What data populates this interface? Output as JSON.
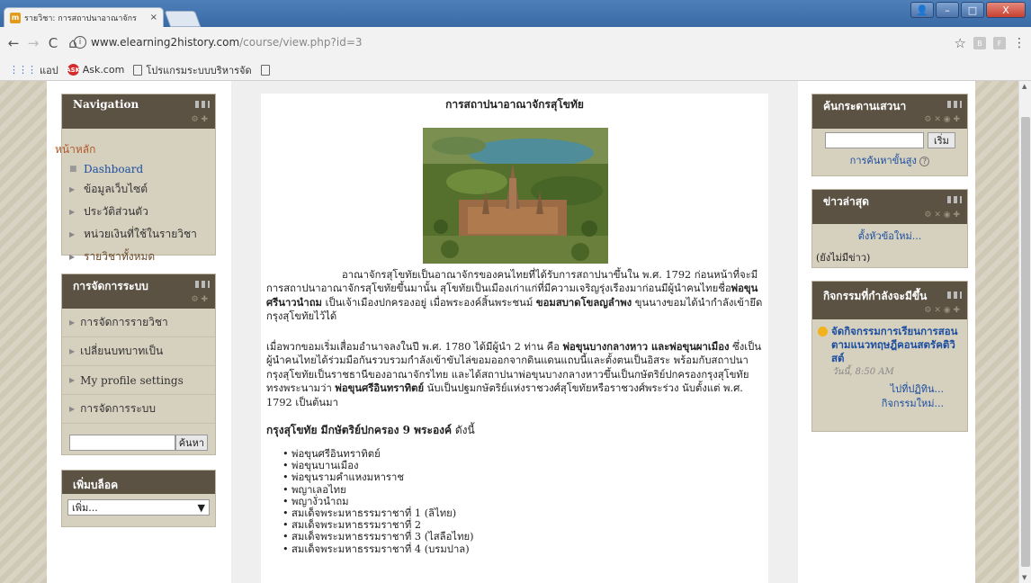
{
  "browser": {
    "tab_title": "รายวิชา: การสถาปนาอาณาจักร",
    "tab_close": "×",
    "url_host": "www.elearning2history.com",
    "url_path": "/course/view.php?id=3",
    "nav_back": "←",
    "nav_forward": "→",
    "nav_reload": "C",
    "nav_home": "⌂",
    "info_icon": "i",
    "star": "☆",
    "ext1": "B",
    "ext2": "F",
    "menu": "⋮",
    "win_min": "–",
    "win_max": "□",
    "win_close": "X"
  },
  "bookmarks": {
    "apps": "แอป",
    "ask": "Ask.com",
    "item1": "โปรแกรมระบบบริหารจัด"
  },
  "navigation": {
    "title": "Navigation",
    "home": "หน้าหลัก",
    "items": [
      "Dashboard",
      "ข้อมูลเว็บไซต์",
      "ประวัติส่วนตัว",
      "หน่วยเงินที่ใช้ในรายวิชา",
      "รายวิชาทั้งหมด"
    ]
  },
  "admin": {
    "title": "การจัดการระบบ",
    "items": [
      "การจัดการรายวิชา",
      "เปลี่ยนบทบาทเป็น",
      "My profile settings",
      "การจัดการระบบ"
    ],
    "search_button": "ค้นหา"
  },
  "addblock": {
    "title": "เพิ่มบล็อค",
    "select_value": "เพิ่ม..."
  },
  "forum_search": {
    "title": "ค้นกระดานเสวนา",
    "button": "เริ่ม",
    "advanced": "การค้นหาขั้นสูง"
  },
  "news": {
    "title": "ข่าวล่าสุด",
    "add": "ตั้งหัวข้อใหม่...",
    "none": "(ยังไม่มีข่าว)"
  },
  "events": {
    "title": "กิจกรรมที่กำลังจะมีขึ้น",
    "event_title": "จัดกิจกรรมการเรียนการสอนตามแนวทฤษฎีคอนสตรัคติวิสต์",
    "event_time": "วันนี้, 8:50 AM",
    "link_goto": "ไปที่ปฏิทิน...",
    "link_new": "กิจกรรมใหม่..."
  },
  "content": {
    "heading": "การสถาปนาอาณาจักรสุโขทัย",
    "para1_a": "อาณาจักรสุโขทัยเป็นอาณาจักรของคนไทยที่ได้รับการสถาปนาขึ้นใน พ.ศ. 1792 ก่อนหน้าที่จะมีการสถาปนาอาณาจักรสุโขทัยขึ้นมานั้น สุโขทัยเป็นเมืองเก่าแก่ที่มีความเจริญรุ่งเรืองมาก่อนมีผู้นำคนไทยชื่อ",
    "para1_b1": "พ่อขุนศรีนาวนำถม",
    "para1_c": " เป็นเจ้าเมืองปกครองอยู่ เมื่อพระองค์สิ้นพระชนม์ ",
    "para1_b2": "ขอมสบาดโขลญลำพง",
    "para1_d": " ขุนนางขอมได้นำกำลังเข้ายึดกรุงสุโขทัยไว้ได้",
    "para2_a": "เมื่อพวกขอมเริ่มเสื่อมอำนาจลงในปี พ.ศ. 1780 ได้มีผู้นำ 2 ท่าน คือ ",
    "para2_b1": "พ่อขุนบางกลางหาว และพ่อขุนผาเมือง",
    "para2_c": " ซึ่งเป็นผู้นำคนไทยได้ร่วมมือกันรวบรวมกำลังเข้าขับไล่ขอมออกจากดินแดนแถบนี้และตั้งตนเป็นอิสระ พร้อมกับสถาปนากรุงสุโขทัยเป็นราชธานีของอาณาจักรไทย และได้สถาปนาพ่อขุนบางกลางหาวขึ้นเป็นกษัตริย์ปกครองกรุงสุโขทัยทรงพระนามว่า ",
    "para2_b2": "พ่อขุนศรีอินทราทิตย์",
    "para2_d": " นับเป็นปฐมกษัตริย์แห่งราชวงศ์สุโขทัยหรือราชวงศ์พระร่วง นับตั้งแต่ พ.ศ. 1792 เป็นต้นมา",
    "kings_heading": "กรุงสุโขทัย มีกษัตริย์ปกครอง 9 พระองค์",
    "kings_heading_suffix": " ดังนี้",
    "kings": [
      "พ่อขุนศรีอินทราทิตย์",
      "พ่อขุนบานเมือง",
      "พ่อขุนรามคำแหงมหาราช",
      "พญาเลอไทย",
      "พญางั่วนำถม",
      "สมเด็จพระมหาธรรมราชาที่ 1 (ลิไทย)",
      "สมเด็จพระมหาธรรมราชาที่ 2",
      "สมเด็จพระมหาธรรมราชาที่ 3 (ไสลือไทย)",
      "สมเด็จพระมหาธรรมราชาที่ 4 (บรมปาล)"
    ]
  }
}
